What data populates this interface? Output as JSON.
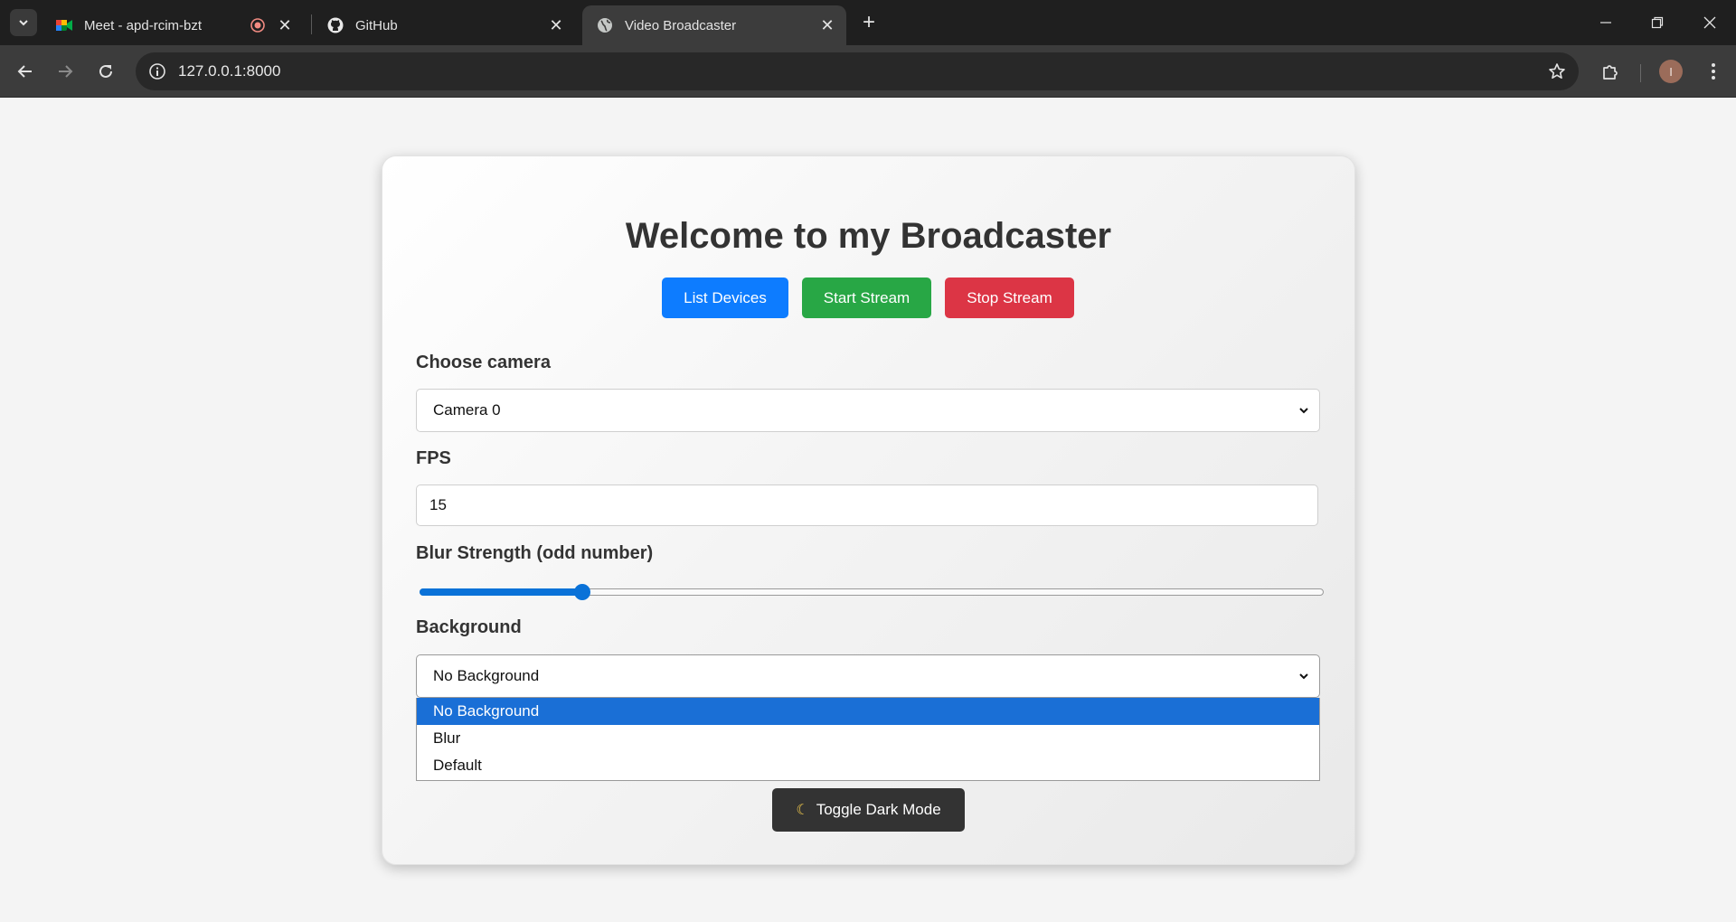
{
  "browser": {
    "tabs": [
      {
        "title": "Meet - apd-rcim-bzt",
        "favicon": "google-meet-icon",
        "recording": true
      },
      {
        "title": "GitHub",
        "favicon": "github-icon"
      },
      {
        "title": "Video Broadcaster",
        "favicon": "globe-icon",
        "active": true
      }
    ],
    "url": "127.0.0.1:8000",
    "profile_initial": "I"
  },
  "page": {
    "title": "Welcome to my Broadcaster",
    "buttons": {
      "list_devices": "List Devices",
      "start_stream": "Start Stream",
      "stop_stream": "Stop Stream"
    },
    "camera": {
      "label": "Choose camera",
      "value": "Camera 0"
    },
    "fps": {
      "label": "FPS",
      "value": "15"
    },
    "blur": {
      "label": "Blur Strength (odd number)",
      "value_fraction": 0.18
    },
    "background": {
      "label": "Background",
      "value": "No Background",
      "options": [
        "No Background",
        "Blur",
        "Default"
      ],
      "selected_index": 0
    },
    "toggle_dark_mode": "Toggle Dark Mode",
    "colors": {
      "blue": "#0d7cff",
      "green": "#28a745",
      "red": "#dc3545",
      "dark": "#333333"
    }
  }
}
